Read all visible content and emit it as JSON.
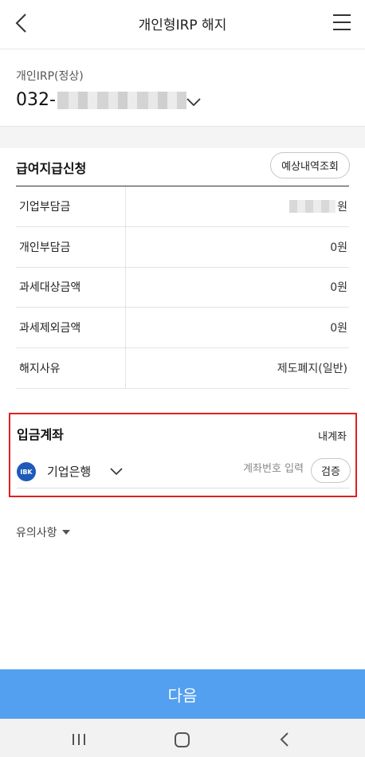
{
  "header": {
    "title": "개인형IRP 해지",
    "icons": {
      "back": "chevron-left-icon",
      "menu": "hamburger-menu-icon"
    }
  },
  "account": {
    "type_label": "개인IRP(정상)",
    "number_prefix": "032-",
    "number_masked": true
  },
  "payout": {
    "title": "급여지급신청",
    "estimate_button": "예상내역조회",
    "rows": [
      {
        "label": "기업부담금",
        "value": "원",
        "masked": true
      },
      {
        "label": "개인부담금",
        "value": "0원"
      },
      {
        "label": "과세대상금액",
        "value": "0원"
      },
      {
        "label": "과세제외금액",
        "value": "0원"
      },
      {
        "label": "해지사유",
        "value": "제도폐지(일반)"
      }
    ]
  },
  "deposit": {
    "title": "입금계좌",
    "my_account_link": "내계좌",
    "bank_logo_text": "IBK",
    "bank_name": "기업은행",
    "account_placeholder": "계좌번호 입력",
    "verify_button": "검증",
    "highlight_color": "#e02020"
  },
  "notice": {
    "label": "유의사항"
  },
  "footer": {
    "next_button": "다음",
    "accent_color": "#53a0f0"
  }
}
